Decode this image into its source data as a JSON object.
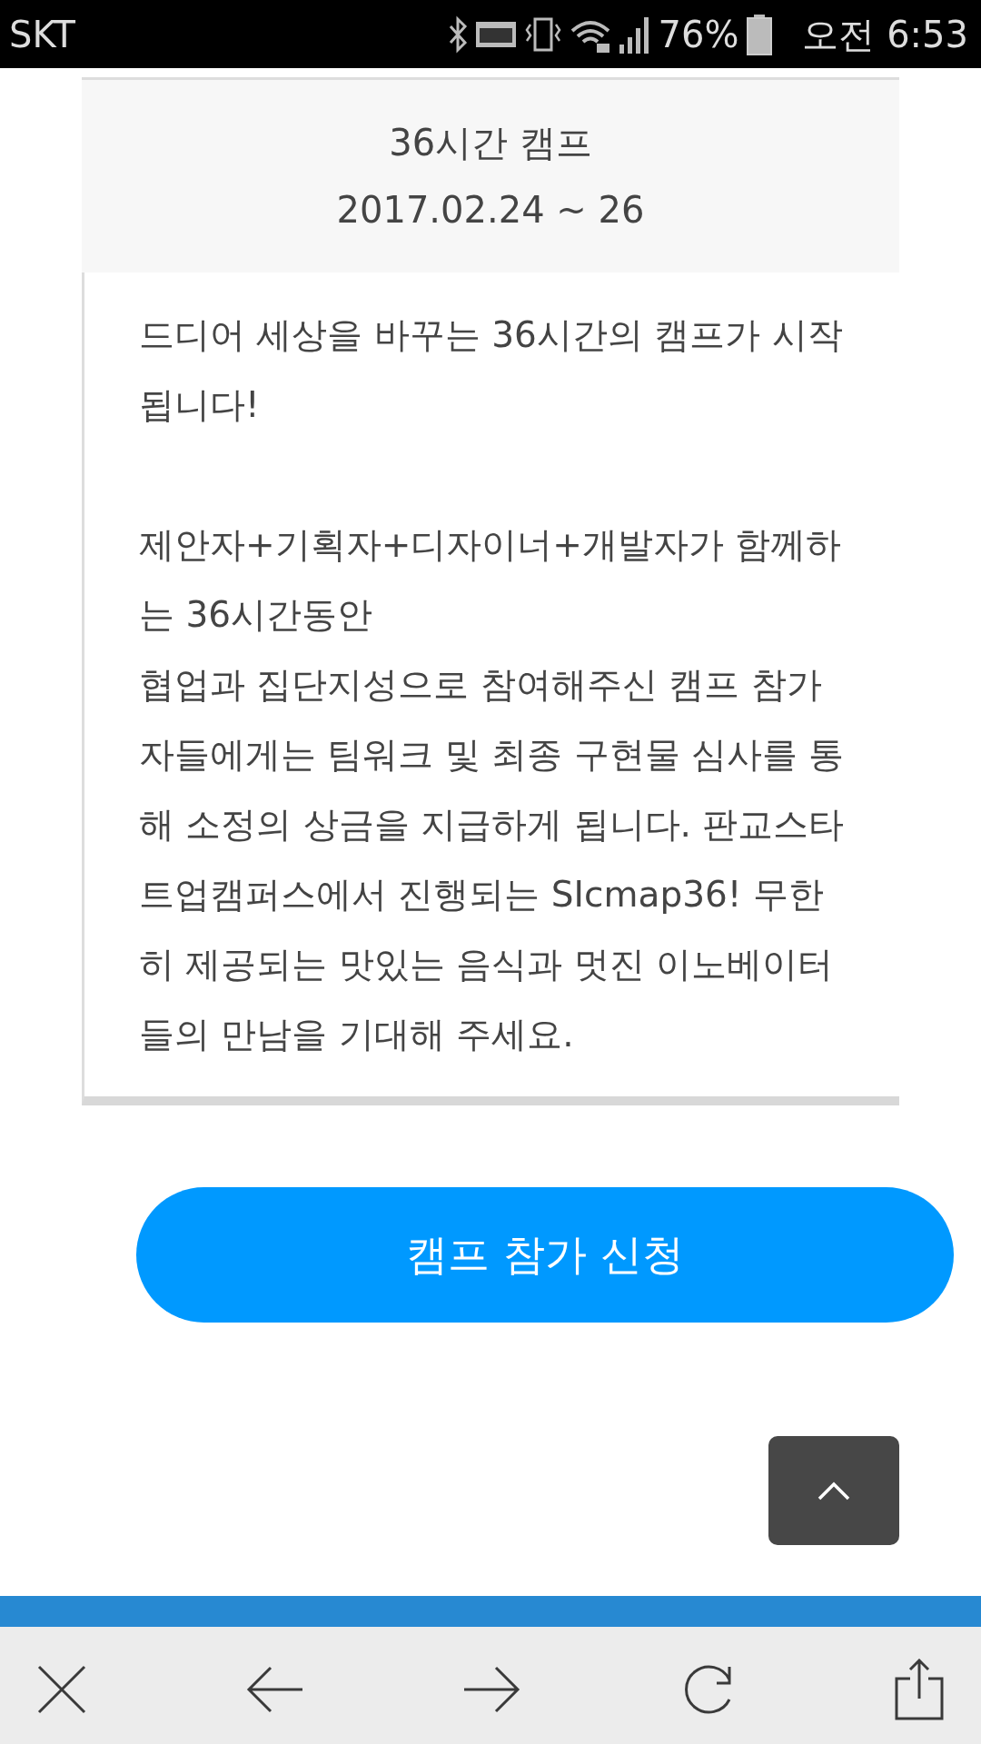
{
  "status_bar": {
    "carrier": "SKT",
    "battery": "76%",
    "time": "오전 6:53"
  },
  "card": {
    "title": "36시간 캠프",
    "date": "2017.02.24 ~ 26",
    "paragraphs": [
      {
        "lines": [
          "드디어 세상을 바꾸는 36시간의 캠프가 시작됩니다!"
        ]
      },
      {
        "lines": [
          "제안자+기획자+디자이너+개발자가 함께하는 36시간동안",
          "협업과 집단지성으로 참여해주신 캠프 참가자들에게는 팀워크 및 최종 구현물 심사를 통해 소정의 상금을 지급하게 됩니다. 판교스타트업캠퍼스에서 진행되는 SIcmap36! 무한히 제공되는 맛있는 음식과 멋진 이노베이터들의 만남을 기대해 주세요."
        ]
      }
    ]
  },
  "apply_button": "캠프 참가 신청"
}
